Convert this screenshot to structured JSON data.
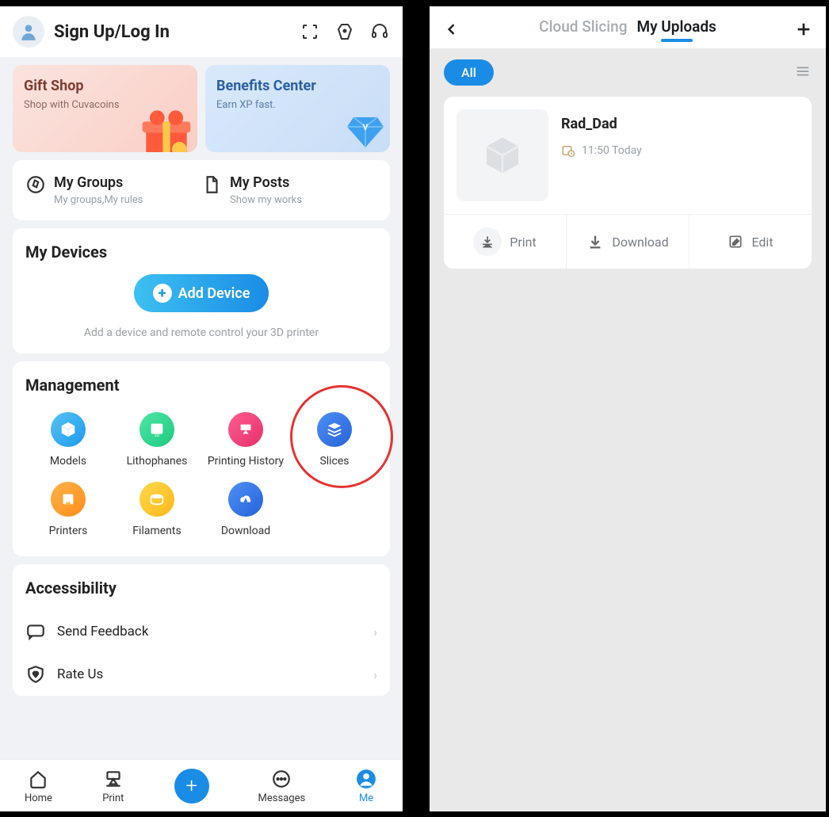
{
  "left": {
    "header": {
      "title": "Sign Up/Log In"
    },
    "promo": {
      "gift_title": "Gift Shop",
      "gift_sub": "Shop with Cuvacoins",
      "benefit_title": "Benefits Center",
      "benefit_sub": "Earn XP fast."
    },
    "groups": {
      "title": "My Groups",
      "sub": "My groups,My rules"
    },
    "posts": {
      "title": "My Posts",
      "sub": "Show my works"
    },
    "devices": {
      "title": "My Devices",
      "add_btn": "Add Device",
      "hint": "Add a device and remote control your 3D printer"
    },
    "management": {
      "title": "Management",
      "items": [
        {
          "label": "Models"
        },
        {
          "label": "Lithophanes"
        },
        {
          "label": "Printing History"
        },
        {
          "label": "Slices"
        },
        {
          "label": "Printers"
        },
        {
          "label": "Filaments"
        },
        {
          "label": "Download"
        }
      ]
    },
    "accessibility": {
      "title": "Accessibility",
      "feedback": "Send Feedback",
      "rate": "Rate Us"
    },
    "nav": {
      "home": "Home",
      "print": "Print",
      "messages": "Messages",
      "me": "Me"
    }
  },
  "right": {
    "tabs": {
      "cloud": "Cloud Slicing",
      "uploads": "My Uploads"
    },
    "filter": {
      "all": "All"
    },
    "item": {
      "name": "Rad_Dad",
      "time": "11:50 Today"
    },
    "actions": {
      "print": "Print",
      "download": "Download",
      "edit": "Edit"
    }
  }
}
